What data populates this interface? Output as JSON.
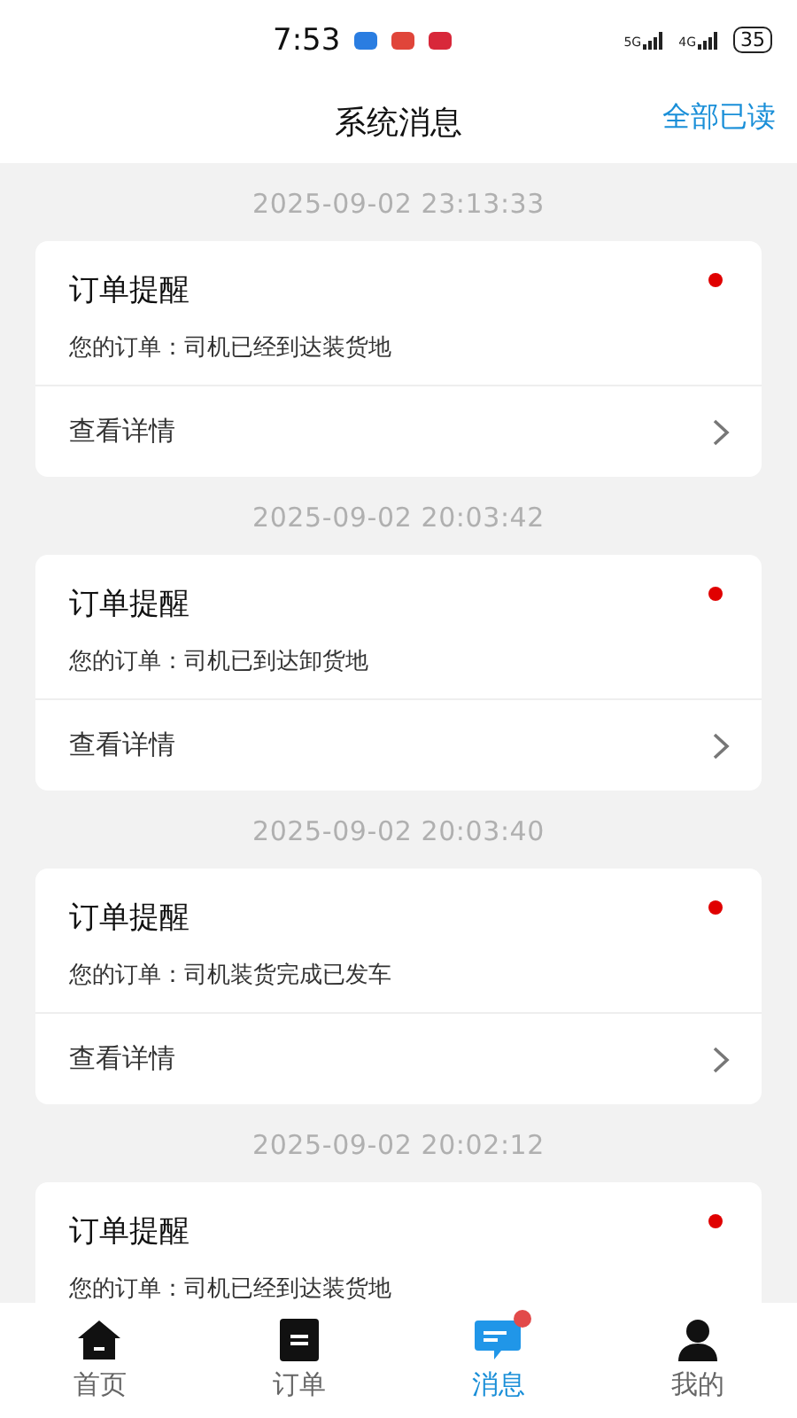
{
  "status_bar": {
    "time": "7:53",
    "signals": [
      "5G",
      "4G"
    ],
    "battery": "35"
  },
  "header": {
    "title": "系统消息",
    "action": "全部已读"
  },
  "messages": [
    {
      "timestamp": "2025-09-02 23:13:33",
      "title": "订单提醒",
      "body": "您的订单：司机已经到达装货地",
      "link": "查看详情",
      "unread": true
    },
    {
      "timestamp": "2025-09-02 20:03:42",
      "title": "订单提醒",
      "body": "您的订单：司机已到达卸货地",
      "link": "查看详情",
      "unread": true
    },
    {
      "timestamp": "2025-09-02 20:03:40",
      "title": "订单提醒",
      "body": "您的订单：司机装货完成已发车",
      "link": "查看详情",
      "unread": true
    },
    {
      "timestamp": "2025-09-02 20:02:12",
      "title": "订单提醒",
      "body": "您的订单：司机已经到达装货地",
      "unread": true
    }
  ],
  "tab_bar": [
    {
      "kind": "home",
      "label": "首页",
      "selected": false,
      "badge": false
    },
    {
      "kind": "orders",
      "label": "订单",
      "selected": false,
      "badge": false
    },
    {
      "kind": "messages",
      "label": "消息",
      "selected": true,
      "badge": true
    },
    {
      "kind": "profile",
      "label": "我的",
      "selected": false,
      "badge": false
    }
  ]
}
